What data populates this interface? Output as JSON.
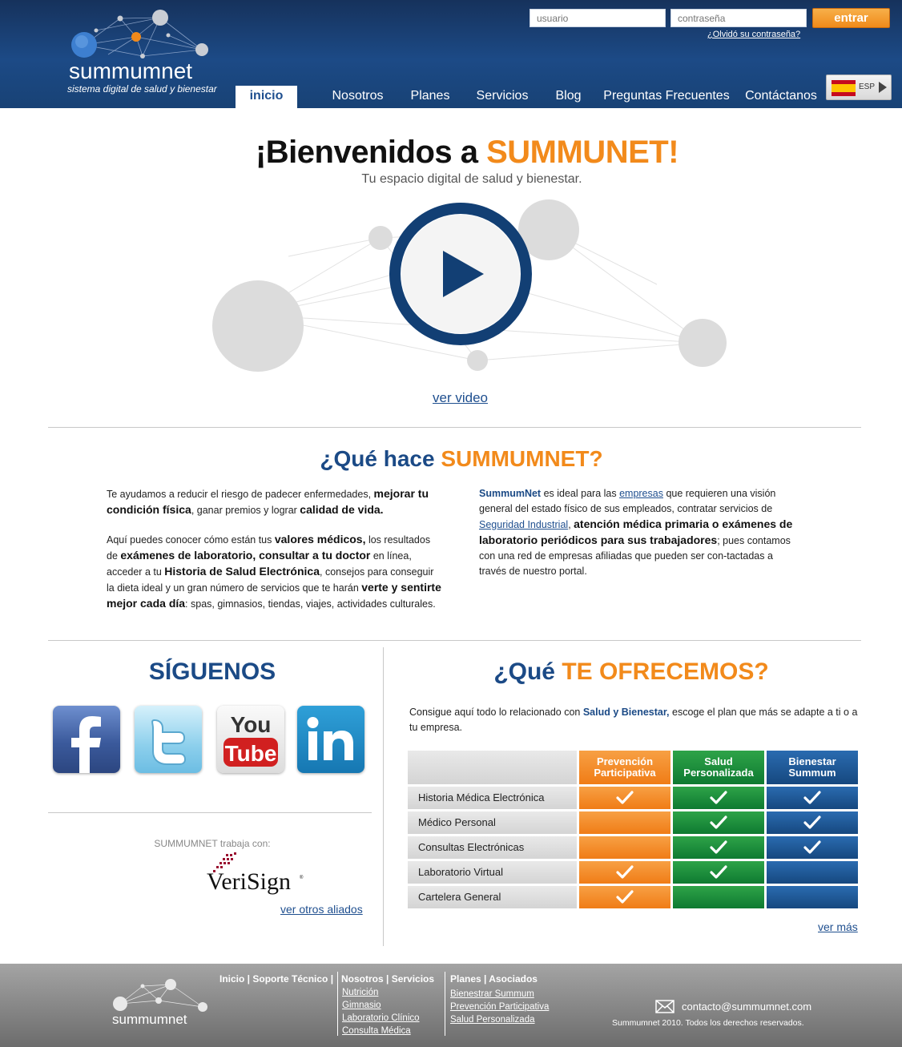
{
  "header": {
    "logo_text": "summumnet",
    "tagline": "sistema digital de salud y bienestar",
    "user_placeholder": "usuario",
    "password_placeholder": "contraseña",
    "login_label": "entrar",
    "forgot_label": "¿Olvidó su contraseña?",
    "language": "ESP",
    "nav": [
      {
        "label": "inicio",
        "active": true
      },
      {
        "label": "Nosotros"
      },
      {
        "label": "Planes"
      },
      {
        "label": "Servicios"
      },
      {
        "label": "Blog"
      },
      {
        "label": "Preguntas Frecuentes"
      },
      {
        "label": "Contáctanos"
      }
    ]
  },
  "hero": {
    "title_prefix": "¡Bienvenidos a ",
    "title_accent": "SUMMUNET!",
    "subtitle": "Tu espacio digital de salud y bienestar.",
    "video_link": "ver video"
  },
  "what": {
    "title_prefix": "¿Qué hace ",
    "title_accent": "SUMMUMNET?",
    "left_p1": [
      "Te ayudamos a reducir el riesgo de padecer enfermedades, ",
      "mejorar tu condición física",
      ",  ganar premios y lograr ",
      "calidad de vida."
    ],
    "left_p2": [
      "Aquí puedes conocer cómo están tus ",
      "valores médicos,",
      " los resultados de ",
      "exámenes de laboratorio, consultar a tu doctor",
      " en línea, acceder a tu ",
      "Historia de Salud Electrónica",
      ", consejos para conseguir la dieta ideal y un gran número de servicios que te harán ",
      "verte y sentirte mejor cada día",
      ": spas, gimnasios, tiendas, viajes, actividades culturales."
    ],
    "right_brand": "SummumNet",
    "right_text_1": " es ideal para las ",
    "right_link_1": "empresas",
    "right_text_2": " que requieren una visión general del estado físico de sus empleados, contratar servicios de ",
    "right_link_2": "Seguridad Industrial",
    "right_text_3": ", ",
    "right_bold": "atención médica primaria o exámenes de laboratorio periódicos para sus trabajadores",
    "right_text_4": "; pues contamos con una red de empresas afiliadas que pueden ser con-tactadas a través de nuestro portal."
  },
  "follow": {
    "title": "SÍGUENOS",
    "partners_text": "SUMMUMNET trabaja con:",
    "partner_logo": "VeriSign",
    "other_partners_link": "ver otros aliados"
  },
  "offer": {
    "title_prefix": "¿Qué ",
    "title_accent": "TE OFRECEMOS?",
    "intro_1": "Consigue aquí todo lo relacionado con ",
    "intro_bold": "Salud y Bienestar,",
    "intro_2": " escoge el plan que más se adapte a ti o a tu empresa.",
    "plans": [
      {
        "name": "Prevención Participativa",
        "color": "#f28a1b"
      },
      {
        "name": "Salud Personalizada",
        "color": "#1a8a3a"
      },
      {
        "name": "Bienestar Summum",
        "color": "#1f5c9d"
      }
    ],
    "features": [
      {
        "label": "Historia Médica Electrónica",
        "checks": [
          true,
          true,
          true
        ]
      },
      {
        "label": "Médico Personal",
        "checks": [
          false,
          true,
          true
        ]
      },
      {
        "label": "Consultas Electrónicas",
        "checks": [
          false,
          true,
          true
        ]
      },
      {
        "label": "Laboratorio Virtual",
        "checks": [
          true,
          true,
          false
        ]
      },
      {
        "label": "Cartelera General",
        "checks": [
          true,
          false,
          false
        ]
      }
    ],
    "more_link": "ver más"
  },
  "footer": {
    "logo_text": "summumnet",
    "col1_head": "Inicio | Soporte Técnico |",
    "col2_head": "Nosotros | Servicios",
    "col2_links": [
      "Nutrición",
      "Gimnasio",
      "Laboratorio Clínico",
      "Consulta Médica"
    ],
    "col3_head": "Planes |  Asociados",
    "col3_links": [
      "Bienestrar Summum",
      "Prevención Participativa",
      "Salud Personalizada"
    ],
    "email": "contacto@summumnet.com",
    "copyright": "Summumnet 2010. Todos los derechos reservados."
  },
  "colors": {
    "brand_blue": "#1b4a86",
    "accent_orange": "#f28a1b"
  }
}
